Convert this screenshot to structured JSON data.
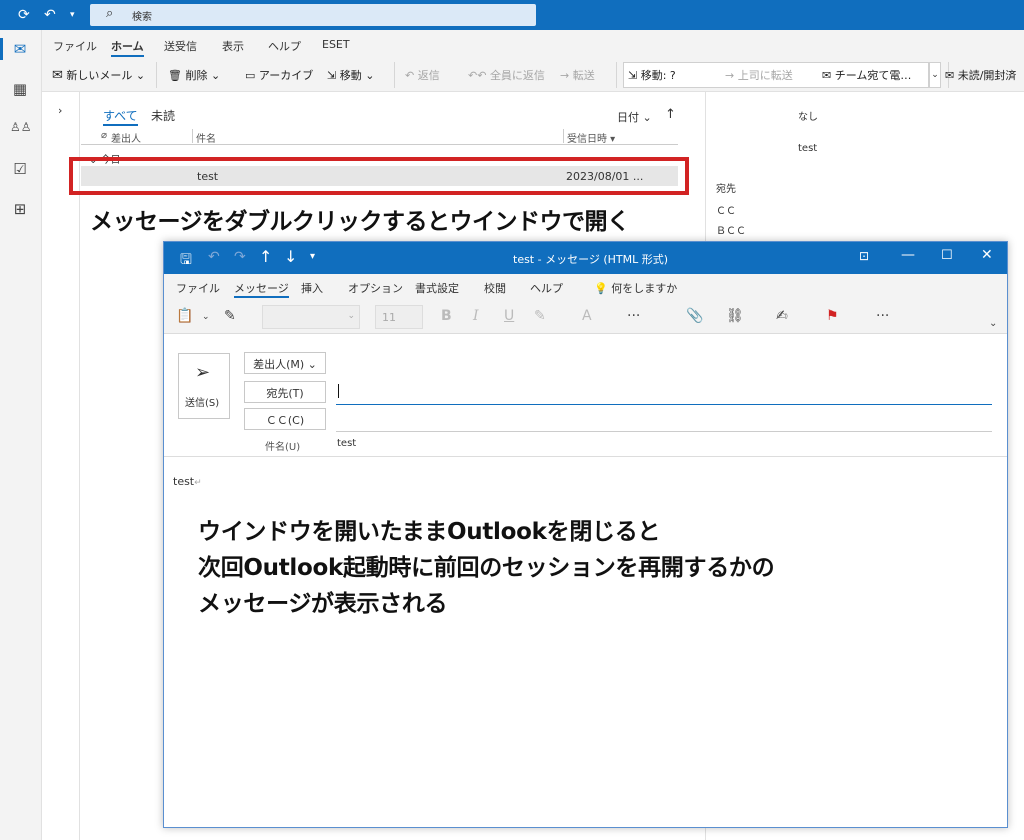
{
  "search": {
    "placeholder": "検索"
  },
  "ribbon_tabs": [
    "ファイル",
    "ホーム",
    "送受信",
    "表示",
    "ヘルプ",
    "ESET"
  ],
  "ribbon": {
    "new_mail": "新しいメール",
    "delete": "削除",
    "archive": "アーカイブ",
    "move": "移動",
    "reply": "返信",
    "reply_all": "全員に返信",
    "forward": "転送",
    "qs_move": "移動: ?",
    "qs_manager": "上司に転送",
    "qs_team": "チーム宛て電…",
    "unread": "未読/開封済"
  },
  "list": {
    "tab_all": "すべて",
    "tab_unread": "未読",
    "sort": "日付",
    "col_sender": "差出人",
    "col_subject": "件名",
    "col_received": "受信日時",
    "group": "今日",
    "row_subject": "test",
    "row_date": "2023/08/01 ..."
  },
  "reading_pane": {
    "none": "なし",
    "subject": "test",
    "to": "宛先",
    "cc": "ＣＣ",
    "bcc": "ＢＣＣ"
  },
  "annotations": {
    "top": "メッセージをダブルクリックするとウインドウで開く",
    "body1": "ウインドウを開いたままOutlookを閉じると",
    "body2": "次回Outlook起動時に前回のセッションを再開するかの",
    "body3": "メッセージが表示される"
  },
  "msg_window": {
    "title": "test - メッセージ (HTML 形式)",
    "tabs": [
      "ファイル",
      "メッセージ",
      "挿入",
      "オプション",
      "書式設定",
      "校閲",
      "ヘルプ"
    ],
    "tell_me": "何をしますか",
    "font_size": "11",
    "send": "送信(S)",
    "from_btn": "差出人(M)",
    "to_btn": "宛先(T)",
    "cc_btn": "ＣＣ(C)",
    "subject_label": "件名(U)",
    "subject_value": "test",
    "body": "test"
  }
}
